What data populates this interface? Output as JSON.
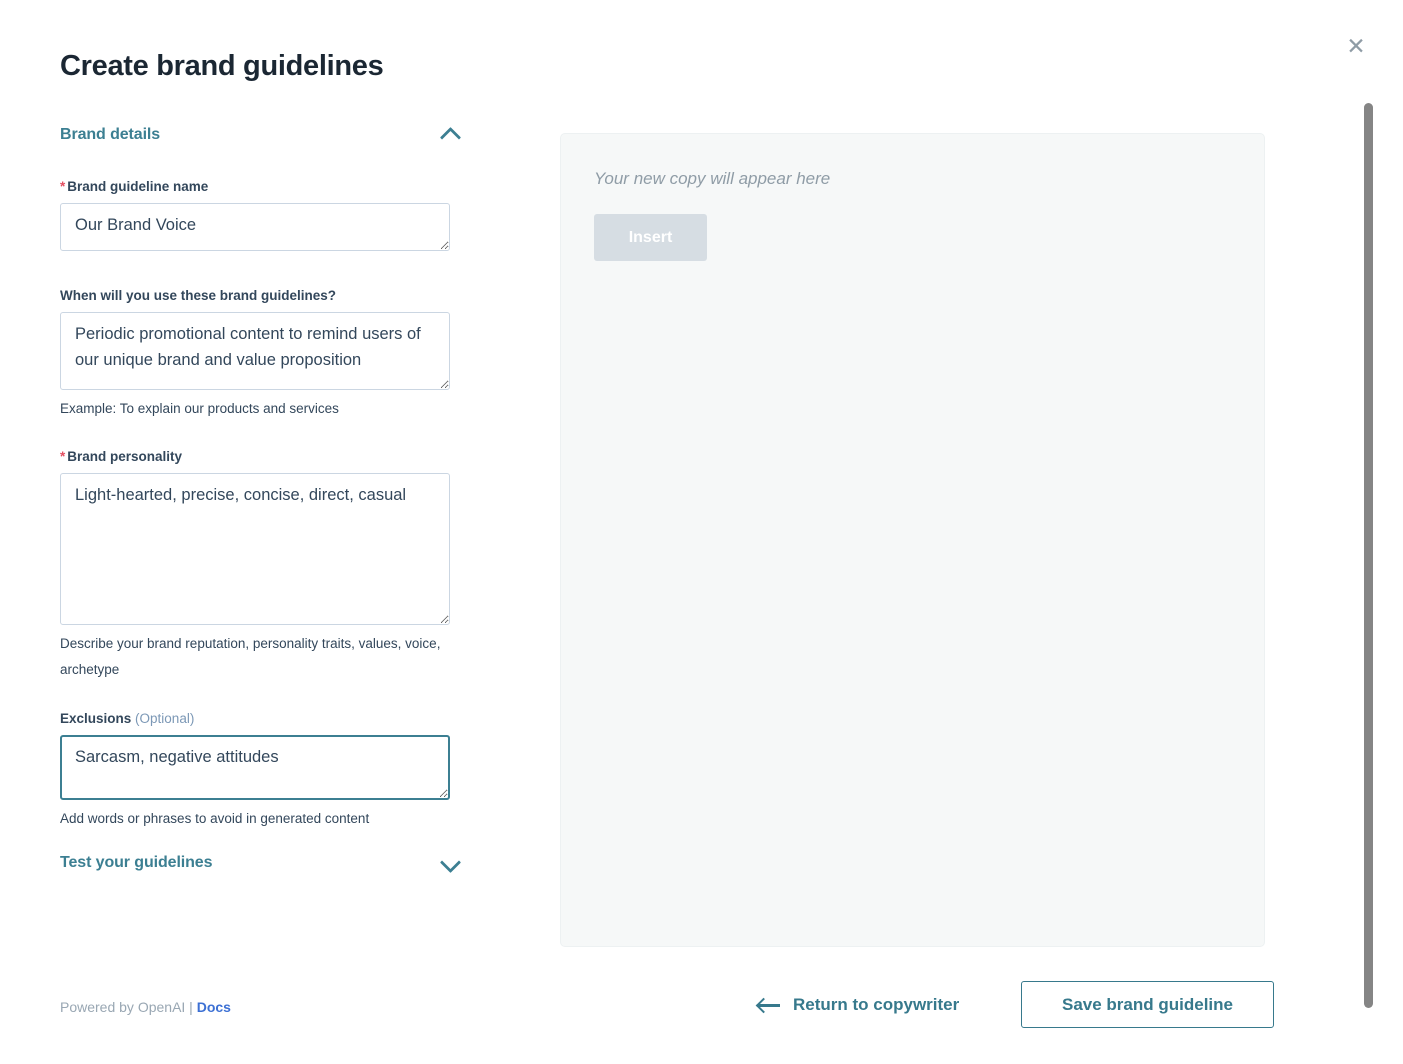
{
  "header": {
    "title": "Create brand guidelines",
    "close_icon": "close-icon"
  },
  "colors": {
    "accent_teal": "#37798c",
    "link_blue": "#3c70d4",
    "required_red": "#e34e61",
    "text_dark": "#33475b",
    "muted": "#8f9ca6",
    "panel_bg": "#f6f8f8",
    "disabled_btn": "#d6dde3"
  },
  "sections": [
    {
      "id": "brand-details",
      "label": "Brand details",
      "expanded": true,
      "chevron_icon": "chevron-up-icon"
    },
    {
      "id": "test-your-guidelines",
      "label": "Test your guidelines",
      "expanded": false,
      "chevron_icon": "chevron-down-icon"
    }
  ],
  "fields": {
    "guideline_name": {
      "label": "Brand guideline name",
      "required": true,
      "value": "Our Brand Voice",
      "placeholder": "",
      "help": ""
    },
    "when_used": {
      "label": "When will you use these brand guidelines?",
      "required": false,
      "value": "Periodic promotional content to remind users of our unique brand and value proposition",
      "placeholder": "",
      "help": "Example: To explain our products and services",
      "scrolled": true
    },
    "brand_personality": {
      "label": "Brand personality",
      "required": true,
      "value": "Light-hearted, precise, concise, direct, casual",
      "placeholder": "",
      "help": "Describe your brand reputation, personality traits, values, voice, archetype"
    },
    "exclusions": {
      "label": "Exclusions",
      "optional_label": "(Optional)",
      "required": false,
      "focused": true,
      "value": "Sarcasm, negative attitudes",
      "placeholder": "",
      "help": "Add words or phrases to avoid in generated content"
    }
  },
  "footer_note": {
    "prefix": "Powered by OpenAI | ",
    "link_label": "Docs"
  },
  "preview": {
    "placeholder": "Your new copy will appear here",
    "insert_label": "Insert",
    "insert_disabled": true
  },
  "actions": {
    "return_label": "Return to copywriter",
    "return_icon": "arrow-left-icon",
    "save_label": "Save brand guideline"
  }
}
